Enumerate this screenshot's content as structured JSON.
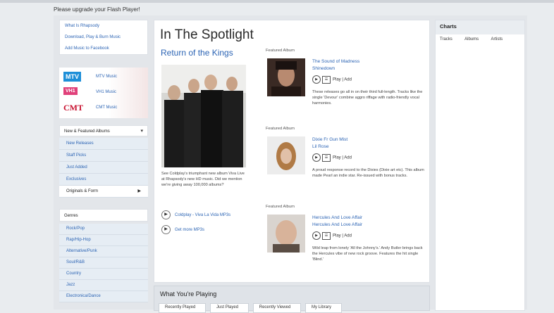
{
  "upgrade_text": "Please upgrade your Flash Player!",
  "sidebar": {
    "links": [
      "What Is Rhapsody",
      "Download, Play & Burn Music",
      "Add Music to Facebook"
    ],
    "partners": [
      {
        "logo": "MTV",
        "label": "MTV Music"
      },
      {
        "logo": "VH1",
        "label": "VH1 Music"
      },
      {
        "logo": "CMT",
        "label": "CMT Music"
      }
    ],
    "menu_header": "New & Featured Albums",
    "menu_items": [
      "New Releases",
      "Staff Picks",
      "Just Added",
      "Exclusives",
      "Originals & Form"
    ],
    "genres_header": "Genres",
    "genres": [
      "Rock/Pop",
      "Rap/Hip-Hop",
      "Alternative/Punk",
      "Soul/R&B",
      "Country",
      "Jazz",
      "Electronica/Dance"
    ]
  },
  "spotlight": {
    "title": "In The Spotlight",
    "subtitle": "Return of the Kings",
    "blurb": "See Coldplay's triumphant new album Viva Live at Rhapsody's new HD music. Did we mention we're giving away 100,000 albums?",
    "links": [
      "Coldplay - Viva La Vida MP3s",
      "Get more MP3s"
    ],
    "featured": [
      {
        "header": "Featured Album",
        "title": "The Sound of Madness",
        "artist": "Shinedown",
        "controls": "Play | Add",
        "desc": "These releases go all in on their third full-length. Tracks like the single 'Devour' combine aggro riffage with radio-friendly vocal harmonies."
      },
      {
        "header": "Featured Album",
        "title": "Dixie Fr Gun Mist",
        "artist": "Lil Rose",
        "controls": "Play | Add",
        "desc": "A proud response record to the Dixies (Dixie art etc). This album made Pearl an indie star. Re-issued with bonus tracks."
      },
      {
        "header": "Featured Album",
        "title": "Hercules And Love Affair",
        "artist": "Hercules And Love Affair",
        "controls": "Play | Add",
        "desc": "Wild leap from lonely 'All the Johnny's.' Andy Butler brings back the Hercules vibe of new rock groove. Features the hit single 'Blind.'"
      }
    ]
  },
  "charts": {
    "title": "Charts",
    "tabs": [
      "Tracks",
      "Albums",
      "Artists"
    ]
  },
  "playing": {
    "title": "What You're Playing",
    "tabs": [
      "Recently Played",
      "Just Played",
      "Recently Viewed",
      "My Library"
    ]
  }
}
